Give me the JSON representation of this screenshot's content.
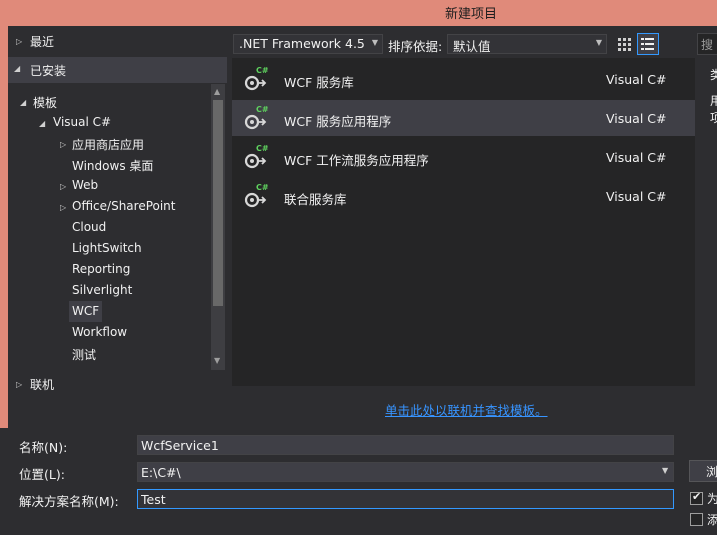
{
  "window": {
    "title": "新建项目"
  },
  "nav": {
    "recent": "最近",
    "installed": "已安装",
    "templates": "模板",
    "visual_csharp": "Visual C#",
    "children": [
      "应用商店应用",
      "Windows 桌面",
      "Web",
      "Office/SharePoint",
      "Cloud",
      "LightSwitch",
      "Reporting",
      "Silverlight",
      "WCF",
      "Workflow",
      "测试"
    ],
    "online": "联机"
  },
  "toolbar": {
    "framework": ".NET Framework 4.5",
    "sort_label": "排序依据:",
    "sort_value": "默认值",
    "search_placeholder": "搜"
  },
  "templates": [
    {
      "name": "WCF 服务库",
      "lang": "Visual C#"
    },
    {
      "name": "WCF 服务应用程序",
      "lang": "Visual C#"
    },
    {
      "name": "WCF 工作流服务应用程序",
      "lang": "Visual C#"
    },
    {
      "name": "联合服务库",
      "lang": "Visual C#"
    }
  ],
  "right_panel": {
    "line1": "类",
    "line2": "用",
    "line3": "项"
  },
  "online_link": "单击此处以联机并查找模板。",
  "form": {
    "name_label": "名称(N):",
    "name_value": "WcfService1",
    "location_label": "位置(L):",
    "location_value": "E:\\C#\\",
    "solution_label": "解决方案名称(M):",
    "solution_value": "Test",
    "browse_label": "浏",
    "check1_label": "为",
    "check2_label": "添"
  },
  "colors": {
    "accent": "#3399ff",
    "title_bar": "#e08a7a",
    "link": "#3794ff",
    "icon_badge": "#5fd35f"
  }
}
